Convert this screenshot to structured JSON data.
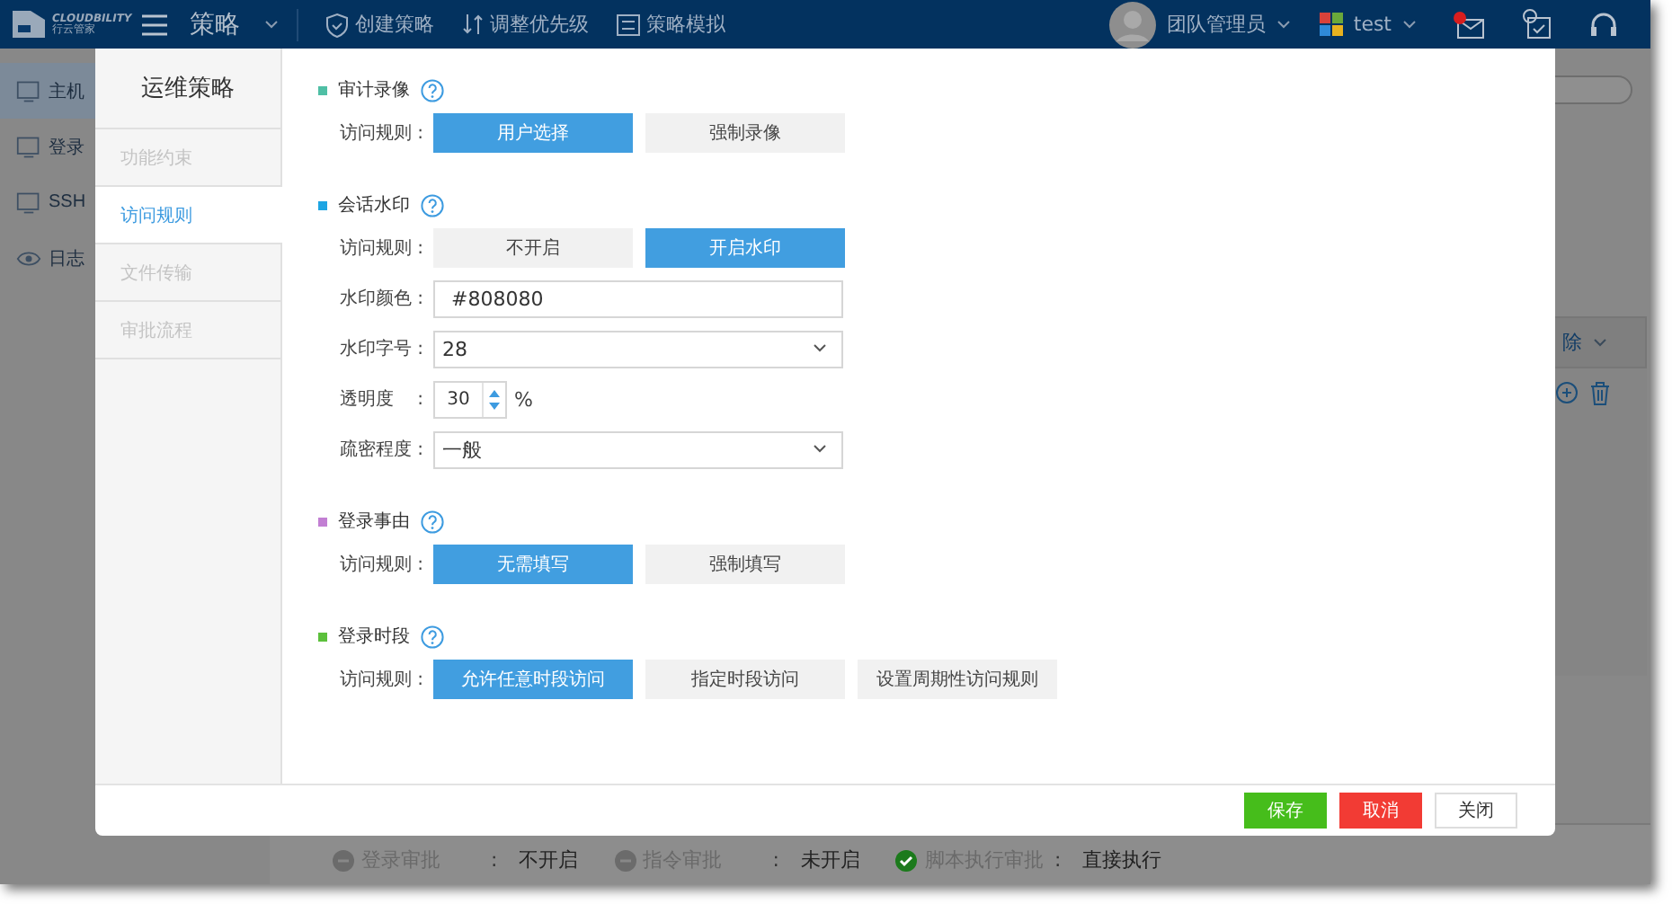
{
  "top_bar": {
    "logo": {
      "name": "CLOUDBILITY",
      "subtitle": "行云管家"
    },
    "title": "策略",
    "actions": [
      {
        "kind": "shield",
        "label": "创建策略"
      },
      {
        "kind": "sort",
        "label": "调整优先级"
      },
      {
        "kind": "simulate",
        "label": "策略模拟"
      }
    ],
    "user": "团队管理员",
    "tenant": "test"
  },
  "sidebar": {
    "items": [
      {
        "label": "主机",
        "kind": "host",
        "selected": true
      },
      {
        "label": "登录",
        "kind": "login",
        "selected": false
      },
      {
        "label": "SSH",
        "kind": "ssh",
        "selected": false
      },
      {
        "label": "日志",
        "kind": "log",
        "selected": false
      }
    ]
  },
  "background_panel": {
    "action": "除"
  },
  "approval_strip": [
    {
      "label": "登录审批",
      "colon": ":",
      "value": "不开启",
      "enabled": false
    },
    {
      "label": "指令审批",
      "colon": ":",
      "value": "未开启",
      "enabled": false
    },
    {
      "label": "脚本执行审批",
      "colon": ":",
      "value": "直接执行",
      "enabled": true
    }
  ],
  "dialog": {
    "title": "运维策略",
    "tabs": [
      {
        "label": "功能约束",
        "selected": false
      },
      {
        "label": "访问规则",
        "selected": true
      },
      {
        "label": "文件传输",
        "selected": false
      },
      {
        "label": "审批流程",
        "selected": false
      }
    ],
    "sections": [
      {
        "title": "审计录像",
        "color": "#4fbfa5",
        "rows": [
          {
            "kind": "options",
            "label": "访问规则 :",
            "options": [
              {
                "label": "用户选择",
                "selected": true
              },
              {
                "label": "强制录像",
                "selected": false
              }
            ]
          }
        ]
      },
      {
        "title": "会话水印",
        "color": "#1ea5e3",
        "rows": [
          {
            "kind": "options",
            "label": "访问规则 :",
            "options": [
              {
                "label": "不开启",
                "selected": false
              },
              {
                "label": "开启水印",
                "selected": true
              }
            ]
          },
          {
            "kind": "text",
            "label": "水印颜色 :",
            "value": "#808080"
          },
          {
            "kind": "select",
            "label": "水印字号 :",
            "value": "28"
          },
          {
            "kind": "spinner",
            "label": "透明度　 :",
            "value": "30",
            "unit": "%"
          },
          {
            "kind": "select",
            "label": "疏密程度 :",
            "value": "一般"
          }
        ]
      },
      {
        "title": "登录事由",
        "color": "#c27fd3",
        "rows": [
          {
            "kind": "options",
            "label": "访问规则 :",
            "options": [
              {
                "label": "无需填写",
                "selected": true
              },
              {
                "label": "强制填写",
                "selected": false
              }
            ]
          }
        ]
      },
      {
        "title": "登录时段",
        "color": "#5cc03c",
        "rows": [
          {
            "kind": "options",
            "label": "访问规则 :",
            "options": [
              {
                "label": "允许任意时段访问",
                "selected": true
              },
              {
                "label": "指定时段访问",
                "selected": false
              },
              {
                "label": "设置周期性访问规则",
                "selected": false
              }
            ]
          }
        ]
      }
    ],
    "buttons": [
      {
        "kind": "primary",
        "label": "保存"
      },
      {
        "kind": "danger",
        "label": "取消"
      },
      {
        "kind": "default",
        "label": "关闭"
      }
    ]
  }
}
